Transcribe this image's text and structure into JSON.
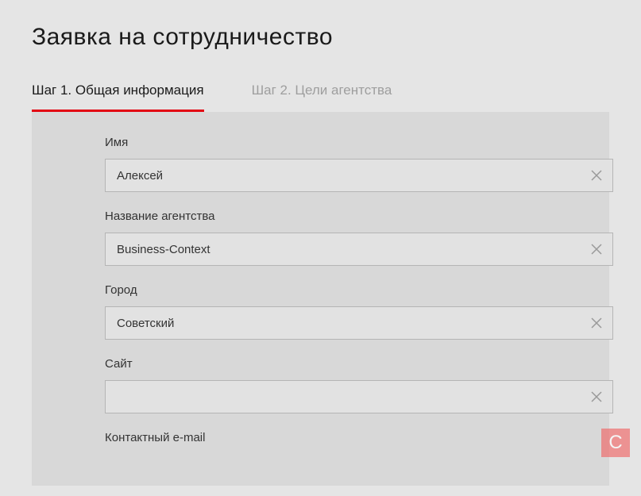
{
  "page": {
    "title": "Заявка на сотрудничество"
  },
  "tabs": [
    {
      "label": "Шаг 1. Общая информация",
      "active": true
    },
    {
      "label": "Шаг 2. Цели агентства",
      "active": false
    }
  ],
  "form": {
    "name": {
      "label": "Имя",
      "value": "Алексей"
    },
    "agency": {
      "label": "Название агентства",
      "value": "Business-Context"
    },
    "city": {
      "label": "Город",
      "value": "Советский"
    },
    "site": {
      "label": "Сайт",
      "value": ""
    },
    "email": {
      "label": "Контактный e-mail",
      "value": ""
    }
  },
  "watermark": "C"
}
